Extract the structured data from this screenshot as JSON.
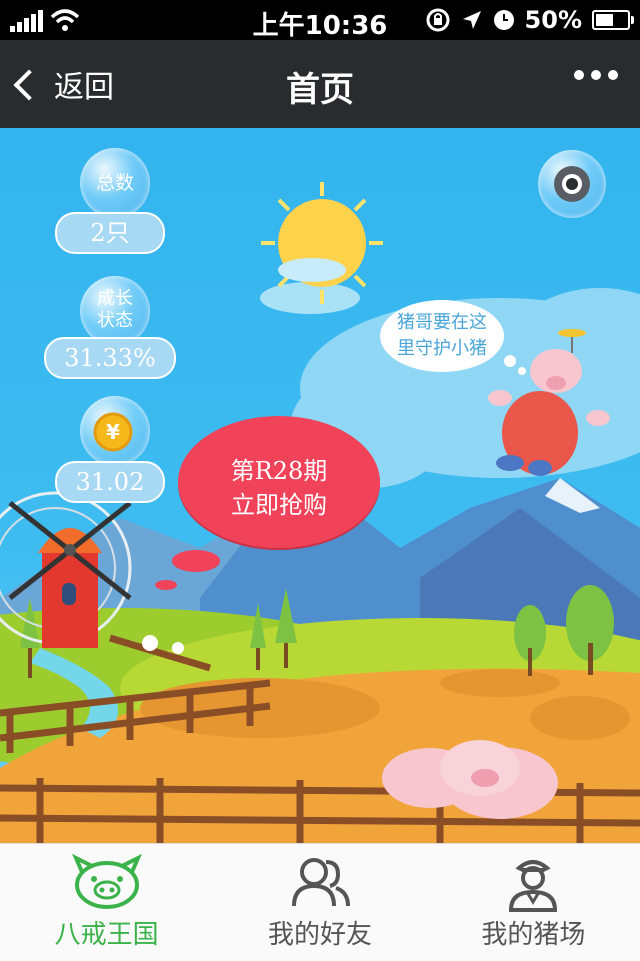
{
  "status_bar": {
    "time": "上午10:36",
    "battery": "50%"
  },
  "nav": {
    "back_label": "返回",
    "title": "首页"
  },
  "scene": {
    "total": {
      "label": "总数",
      "value": "2只"
    },
    "growth": {
      "label_line1": "成长",
      "label_line2": "状态",
      "value": "31.33%"
    },
    "coins": {
      "value": "31.02"
    },
    "speech": {
      "line1": "猪哥要在这",
      "line2": "里守护小猪"
    },
    "purchase": {
      "line1": "第R28期",
      "line2": "立即抢购"
    }
  },
  "tabs": [
    {
      "label": "八戒王国",
      "icon": "pig-icon",
      "active": true
    },
    {
      "label": "我的好友",
      "icon": "friends-icon",
      "active": false
    },
    {
      "label": "我的猪场",
      "icon": "farmer-icon",
      "active": false
    }
  ],
  "colors": {
    "accent_green": "#3bb34a",
    "sky": "#3fbdf1",
    "purchase_red": "#f0435a",
    "nav_bg": "#2a2b2f"
  }
}
